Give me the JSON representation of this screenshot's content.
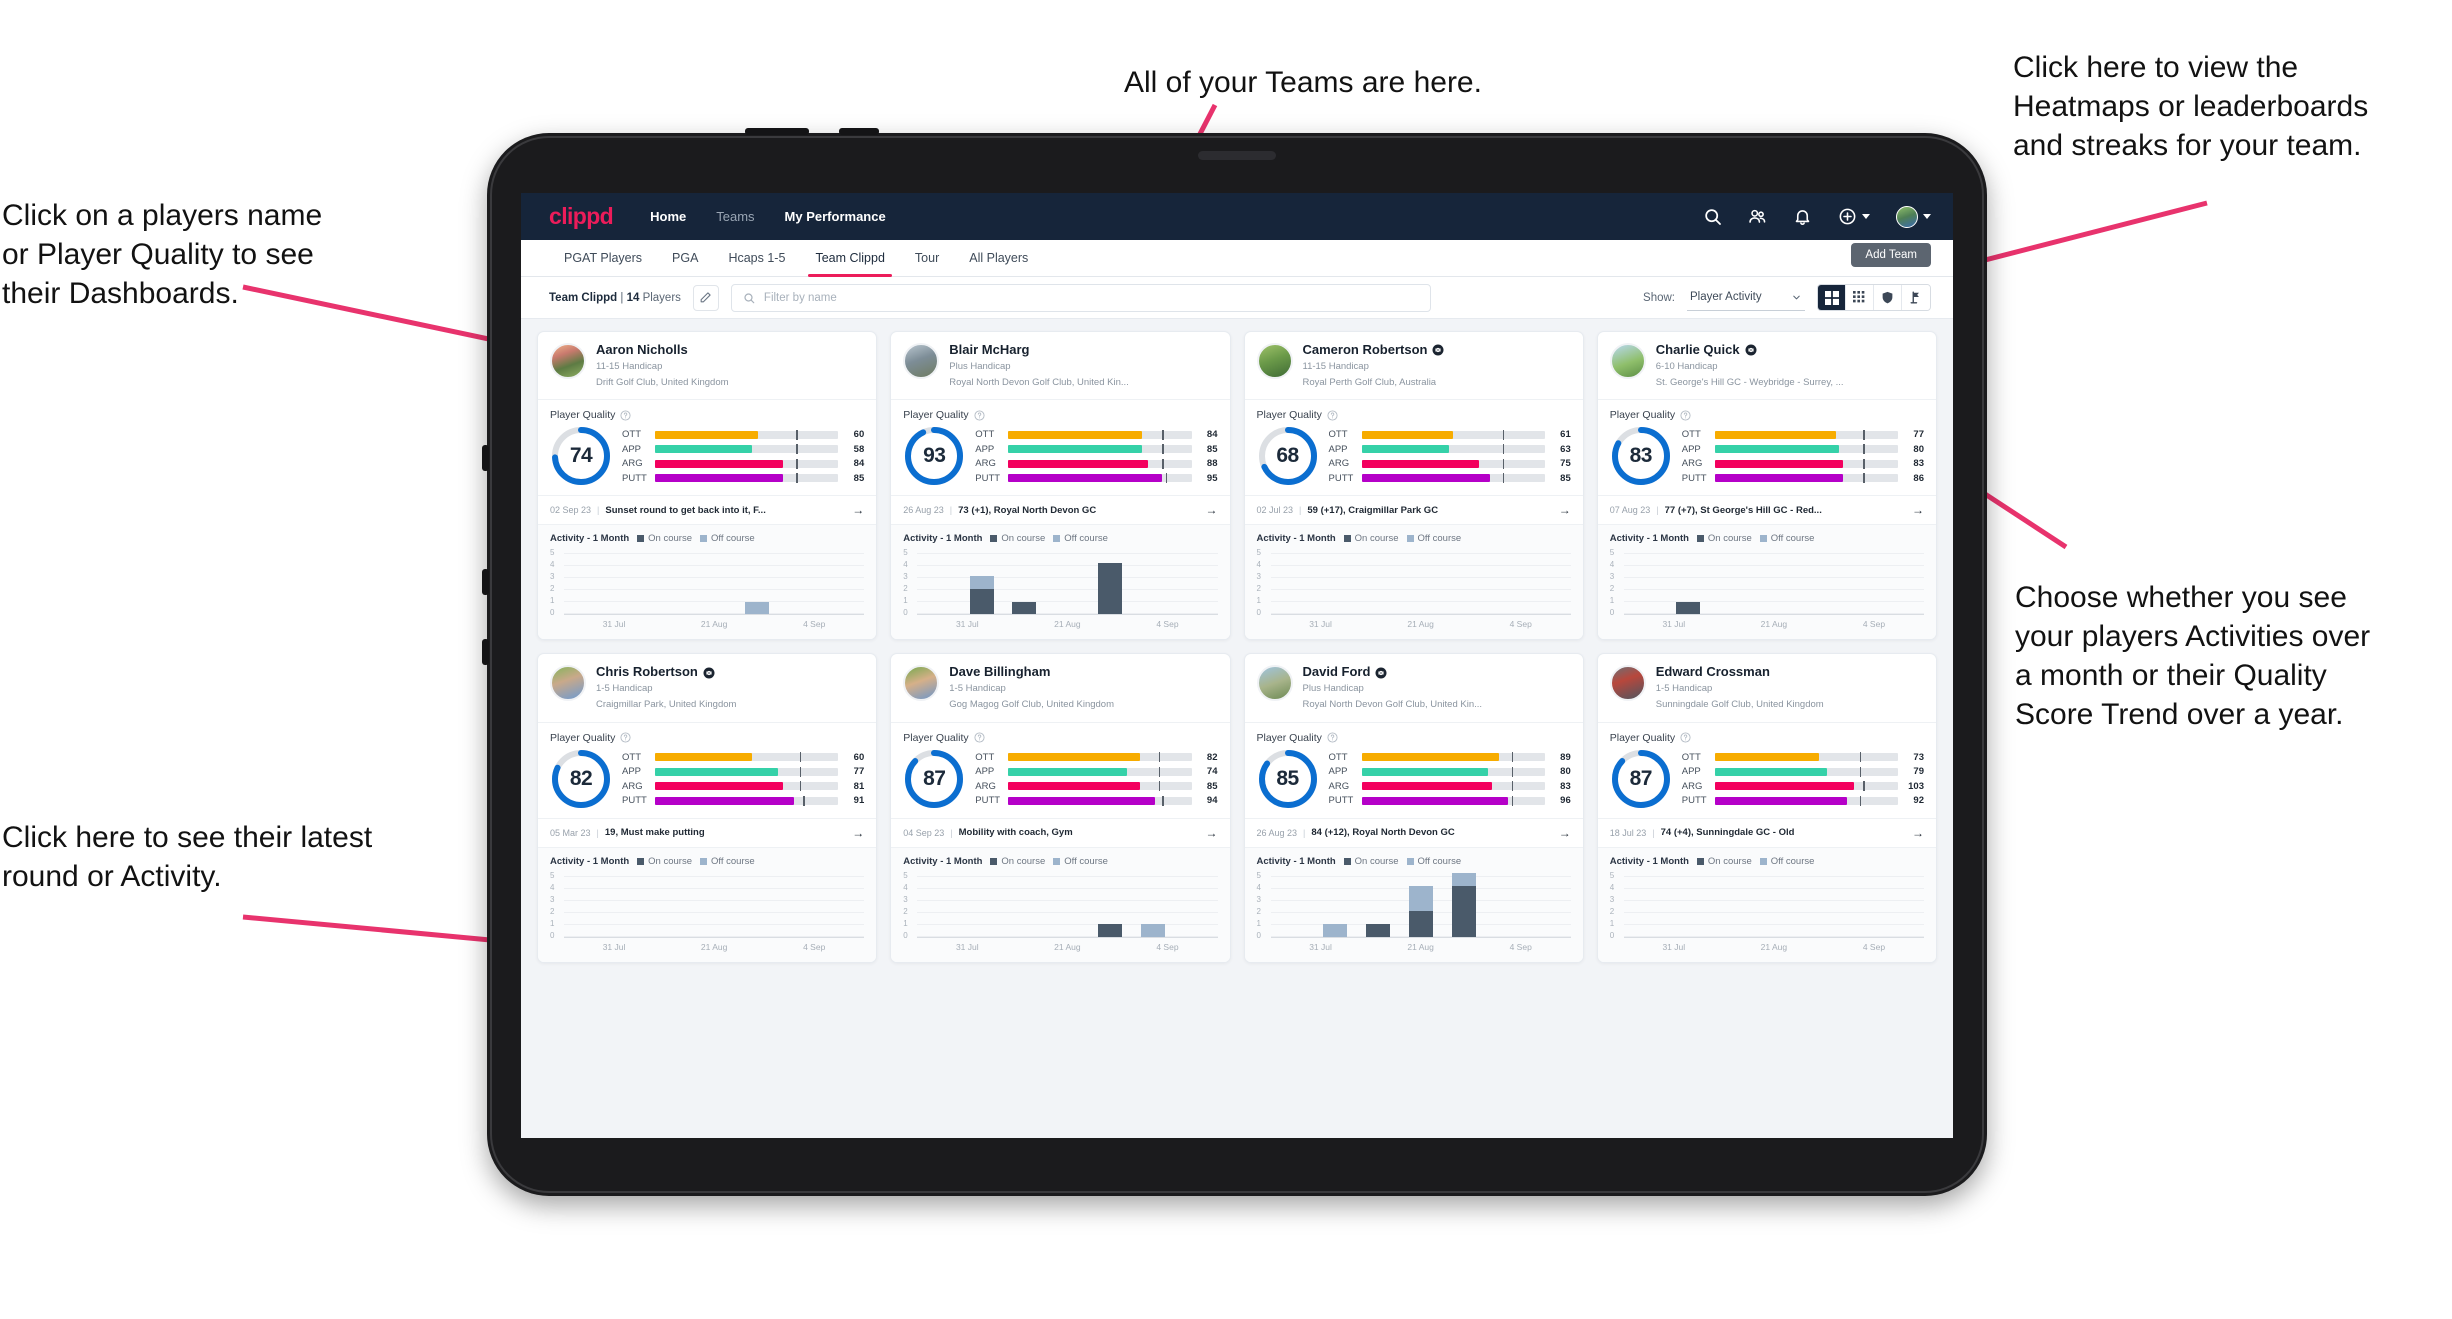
{
  "annotations": [
    {
      "id": "teams",
      "text": "All of your Teams are here."
    },
    {
      "id": "heatmaps",
      "text": "Click here to view the\nHeatmaps or leaderboards\nand streaks for your team."
    },
    {
      "id": "players-name",
      "text": "Click on a players name\nor Player Quality to see\ntheir Dashboards."
    },
    {
      "id": "activity-choice",
      "text": "Choose whether you see\nyour players Activities over\na month or their Quality\nScore Trend over a year."
    },
    {
      "id": "latest-round",
      "text": "Click here to see their latest\nround or Activity."
    }
  ],
  "app": {
    "logo": "clippd",
    "nav": [
      {
        "label": "Home",
        "active": true
      },
      {
        "label": "Teams",
        "active": false
      },
      {
        "label": "My Performance",
        "active": true
      }
    ],
    "icons": {
      "search": "search-icon",
      "people": "people-icon",
      "bell": "bell-icon",
      "plus": "plus-circle-icon",
      "avatar": "avatar-icon"
    },
    "tabs": [
      {
        "label": "PGAT Players",
        "active": false
      },
      {
        "label": "PGA",
        "active": false
      },
      {
        "label": "Hcaps 1-5",
        "active": false
      },
      {
        "label": "Team Clippd",
        "active": true
      },
      {
        "label": "Tour",
        "active": false
      },
      {
        "label": "All Players",
        "active": false
      }
    ],
    "add_team_label": "Add Team",
    "filter": {
      "team_name": "Team Clippd",
      "separator": "|",
      "player_count": "14",
      "players_word": "Players",
      "edit_icon": "pencil-icon",
      "search_placeholder": "Filter by name",
      "show_label": "Show:",
      "show_value": "Player Activity",
      "view_buttons": [
        {
          "name": "grid-large-view",
          "active": true
        },
        {
          "name": "grid-small-view",
          "active": false
        },
        {
          "name": "heatmap-view",
          "active": false
        },
        {
          "name": "leaderboard-view",
          "active": false
        }
      ]
    },
    "card_labels": {
      "player_quality": "Player Quality",
      "activity_title": "Activity - 1 Month",
      "legend_on": "On course",
      "legend_off": "Off course",
      "arrow": "→"
    },
    "chart_axis": {
      "y_ticks": [
        "5",
        "4",
        "3",
        "2",
        "1",
        "0"
      ],
      "x_ticks": [
        "31 Jul",
        "21 Aug",
        "4 Sep"
      ]
    },
    "metric_colors": {
      "OTT": "#f7ac00",
      "APP": "#35d1a8",
      "ARG": "#f3005e",
      "PUTT": "#b500c8",
      "ring": "#0b6ed0",
      "ring_track": "#dcdfe3"
    }
  },
  "chart_data": {
    "type": "bar",
    "title": "Activity - 1 Month",
    "ylabel": "",
    "xlabel": "",
    "ylim": [
      0,
      5
    ],
    "categories": [
      "31 Jul",
      "21 Aug",
      "4 Sep"
    ],
    "series_names": [
      "On course",
      "Off course"
    ],
    "bins": 7
  },
  "players": [
    {
      "name": "Aaron Nicholls",
      "verified": false,
      "handicap": "11-15 Handicap",
      "club": "Drift Golf Club, United Kingdom",
      "quality": 74,
      "metrics": [
        {
          "label": "OTT",
          "value": 60,
          "fill_pct": 56,
          "tick_pct": 77
        },
        {
          "label": "APP",
          "value": 58,
          "fill_pct": 53,
          "tick_pct": 77
        },
        {
          "label": "ARG",
          "value": 84,
          "fill_pct": 70,
          "tick_pct": 77
        },
        {
          "label": "PUTT",
          "value": 85,
          "fill_pct": 70,
          "tick_pct": 77
        }
      ],
      "last_date": "02 Sep 23",
      "last_text": "Sunset round to get back into it, F...",
      "activity": [
        {
          "on": 0,
          "off": 0
        },
        {
          "on": 0,
          "off": 0
        },
        {
          "on": 0,
          "off": 0
        },
        {
          "on": 0,
          "off": 0
        },
        {
          "on": 0,
          "off": 1
        },
        {
          "on": 0,
          "off": 0
        },
        {
          "on": 0,
          "off": 0
        }
      ]
    },
    {
      "name": "Blair McHarg",
      "verified": false,
      "handicap": "Plus Handicap",
      "club": "Royal North Devon Golf Club, United Kin...",
      "quality": 93,
      "metrics": [
        {
          "label": "OTT",
          "value": 84,
          "fill_pct": 73,
          "tick_pct": 84
        },
        {
          "label": "APP",
          "value": 85,
          "fill_pct": 73,
          "tick_pct": 84
        },
        {
          "label": "ARG",
          "value": 88,
          "fill_pct": 76,
          "tick_pct": 84
        },
        {
          "label": "PUTT",
          "value": 95,
          "fill_pct": 84,
          "tick_pct": 86
        }
      ],
      "last_date": "26 Aug 23",
      "last_text": "73 (+1), Royal North Devon GC",
      "activity": [
        {
          "on": 0,
          "off": 0
        },
        {
          "on": 2,
          "off": 1
        },
        {
          "on": 1,
          "off": 0
        },
        {
          "on": 0,
          "off": 0
        },
        {
          "on": 4,
          "off": 0
        },
        {
          "on": 0,
          "off": 0
        },
        {
          "on": 0,
          "off": 0
        }
      ]
    },
    {
      "name": "Cameron Robertson",
      "verified": true,
      "handicap": "11-15 Handicap",
      "club": "Royal Perth Golf Club, Australia",
      "quality": 68,
      "metrics": [
        {
          "label": "OTT",
          "value": 61,
          "fill_pct": 50,
          "tick_pct": 77
        },
        {
          "label": "APP",
          "value": 63,
          "fill_pct": 48,
          "tick_pct": 77
        },
        {
          "label": "ARG",
          "value": 75,
          "fill_pct": 64,
          "tick_pct": 77
        },
        {
          "label": "PUTT",
          "value": 85,
          "fill_pct": 70,
          "tick_pct": 77
        }
      ],
      "last_date": "02 Jul 23",
      "last_text": "59 (+17), Craigmillar Park GC",
      "activity": [
        {
          "on": 0,
          "off": 0
        },
        {
          "on": 0,
          "off": 0
        },
        {
          "on": 0,
          "off": 0
        },
        {
          "on": 0,
          "off": 0
        },
        {
          "on": 0,
          "off": 0
        },
        {
          "on": 0,
          "off": 0
        },
        {
          "on": 0,
          "off": 0
        }
      ]
    },
    {
      "name": "Charlie Quick",
      "verified": true,
      "handicap": "6-10 Handicap",
      "club": "St. George's Hill GC - Weybridge - Surrey, ...",
      "quality": 83,
      "metrics": [
        {
          "label": "OTT",
          "value": 77,
          "fill_pct": 66,
          "tick_pct": 81
        },
        {
          "label": "APP",
          "value": 80,
          "fill_pct": 68,
          "tick_pct": 81
        },
        {
          "label": "ARG",
          "value": 83,
          "fill_pct": 70,
          "tick_pct": 81
        },
        {
          "label": "PUTT",
          "value": 86,
          "fill_pct": 70,
          "tick_pct": 81
        }
      ],
      "last_date": "07 Aug 23",
      "last_text": "77 (+7), St George's Hill GC - Red...",
      "activity": [
        {
          "on": 0,
          "off": 0
        },
        {
          "on": 1,
          "off": 0
        },
        {
          "on": 0,
          "off": 0
        },
        {
          "on": 0,
          "off": 0
        },
        {
          "on": 0,
          "off": 0
        },
        {
          "on": 0,
          "off": 0
        },
        {
          "on": 0,
          "off": 0
        }
      ]
    },
    {
      "name": "Chris Robertson",
      "verified": true,
      "handicap": "1-5 Handicap",
      "club": "Craigmillar Park, United Kingdom",
      "quality": 82,
      "metrics": [
        {
          "label": "OTT",
          "value": 60,
          "fill_pct": 53,
          "tick_pct": 79
        },
        {
          "label": "APP",
          "value": 77,
          "fill_pct": 67,
          "tick_pct": 79
        },
        {
          "label": "ARG",
          "value": 81,
          "fill_pct": 70,
          "tick_pct": 79
        },
        {
          "label": "PUTT",
          "value": 91,
          "fill_pct": 76,
          "tick_pct": 81
        }
      ],
      "last_date": "05 Mar 23",
      "last_text": "19, Must make putting",
      "activity": [
        {
          "on": 0,
          "off": 0
        },
        {
          "on": 0,
          "off": 0
        },
        {
          "on": 0,
          "off": 0
        },
        {
          "on": 0,
          "off": 0
        },
        {
          "on": 0,
          "off": 0
        },
        {
          "on": 0,
          "off": 0
        },
        {
          "on": 0,
          "off": 0
        }
      ]
    },
    {
      "name": "Dave Billingham",
      "verified": false,
      "handicap": "1-5 Handicap",
      "club": "Gog Magog Golf Club, United Kingdom",
      "quality": 87,
      "metrics": [
        {
          "label": "OTT",
          "value": 82,
          "fill_pct": 72,
          "tick_pct": 82
        },
        {
          "label": "APP",
          "value": 74,
          "fill_pct": 65,
          "tick_pct": 82
        },
        {
          "label": "ARG",
          "value": 85,
          "fill_pct": 72,
          "tick_pct": 82
        },
        {
          "label": "PUTT",
          "value": 94,
          "fill_pct": 80,
          "tick_pct": 84
        }
      ],
      "last_date": "04 Sep 23",
      "last_text": "Mobility with coach, Gym",
      "activity": [
        {
          "on": 0,
          "off": 0
        },
        {
          "on": 0,
          "off": 0
        },
        {
          "on": 0,
          "off": 0
        },
        {
          "on": 0,
          "off": 0
        },
        {
          "on": 1,
          "off": 0
        },
        {
          "on": 0,
          "off": 1
        },
        {
          "on": 0,
          "off": 0
        }
      ]
    },
    {
      "name": "David Ford",
      "verified": true,
      "handicap": "Plus Handicap",
      "club": "Royal North Devon Golf Club, United Kin...",
      "quality": 85,
      "metrics": [
        {
          "label": "OTT",
          "value": 89,
          "fill_pct": 75,
          "tick_pct": 82
        },
        {
          "label": "APP",
          "value": 80,
          "fill_pct": 69,
          "tick_pct": 82
        },
        {
          "label": "ARG",
          "value": 83,
          "fill_pct": 71,
          "tick_pct": 82
        },
        {
          "label": "PUTT",
          "value": 96,
          "fill_pct": 80,
          "tick_pct": 82
        }
      ],
      "last_date": "26 Aug 23",
      "last_text": "84 (+12), Royal North Devon GC",
      "activity": [
        {
          "on": 0,
          "off": 0
        },
        {
          "on": 0,
          "off": 1
        },
        {
          "on": 1,
          "off": 0
        },
        {
          "on": 2,
          "off": 2
        },
        {
          "on": 4,
          "off": 1
        },
        {
          "on": 0,
          "off": 0
        },
        {
          "on": 0,
          "off": 0
        }
      ]
    },
    {
      "name": "Edward Crossman",
      "verified": false,
      "handicap": "1-5 Handicap",
      "club": "Sunningdale Golf Club, United Kingdom",
      "quality": 87,
      "metrics": [
        {
          "label": "OTT",
          "value": 73,
          "fill_pct": 57,
          "tick_pct": 79
        },
        {
          "label": "APP",
          "value": 79,
          "fill_pct": 61,
          "tick_pct": 79
        },
        {
          "label": "ARG",
          "value": 103,
          "fill_pct": 76,
          "tick_pct": 81
        },
        {
          "label": "PUTT",
          "value": 92,
          "fill_pct": 72,
          "tick_pct": 79
        }
      ],
      "last_date": "18 Jul 23",
      "last_text": "74 (+4), Sunningdale GC - Old",
      "activity": [
        {
          "on": 0,
          "off": 0
        },
        {
          "on": 0,
          "off": 0
        },
        {
          "on": 0,
          "off": 0
        },
        {
          "on": 0,
          "off": 0
        },
        {
          "on": 0,
          "off": 0
        },
        {
          "on": 0,
          "off": 0
        },
        {
          "on": 0,
          "off": 0
        }
      ]
    }
  ]
}
